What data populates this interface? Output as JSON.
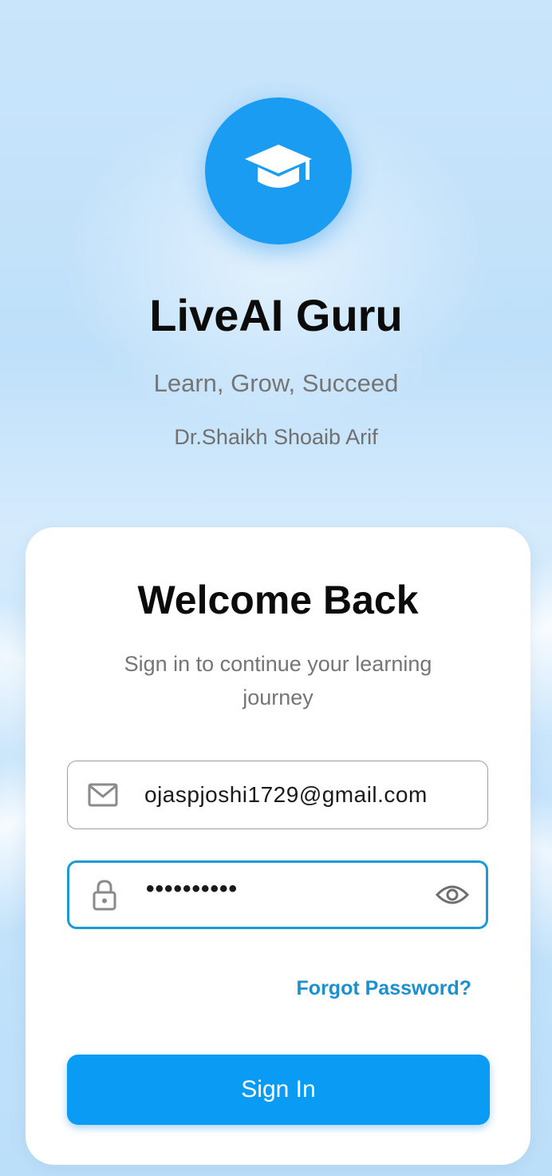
{
  "app": {
    "title": "LiveAI Guru",
    "tagline": "Learn, Grow, Succeed",
    "author": "Dr.Shaikh Shoaib Arif",
    "logo_icon": "graduation-cap-icon"
  },
  "login": {
    "heading": "Welcome Back",
    "subtitle": "Sign in to continue your learning journey",
    "email_value": "ojaspjoshi1729@gmail.com",
    "email_icon": "mail-icon",
    "password_value": "••••••••••",
    "password_icon": "lock-icon",
    "visibility_icon": "eye-icon",
    "forgot_label": "Forgot Password?",
    "signin_label": "Sign In"
  },
  "colors": {
    "accent": "#1b9cf3",
    "link": "#1c8fcf",
    "focused_border": "#1b9ad6",
    "button": "#0a9bf5"
  }
}
